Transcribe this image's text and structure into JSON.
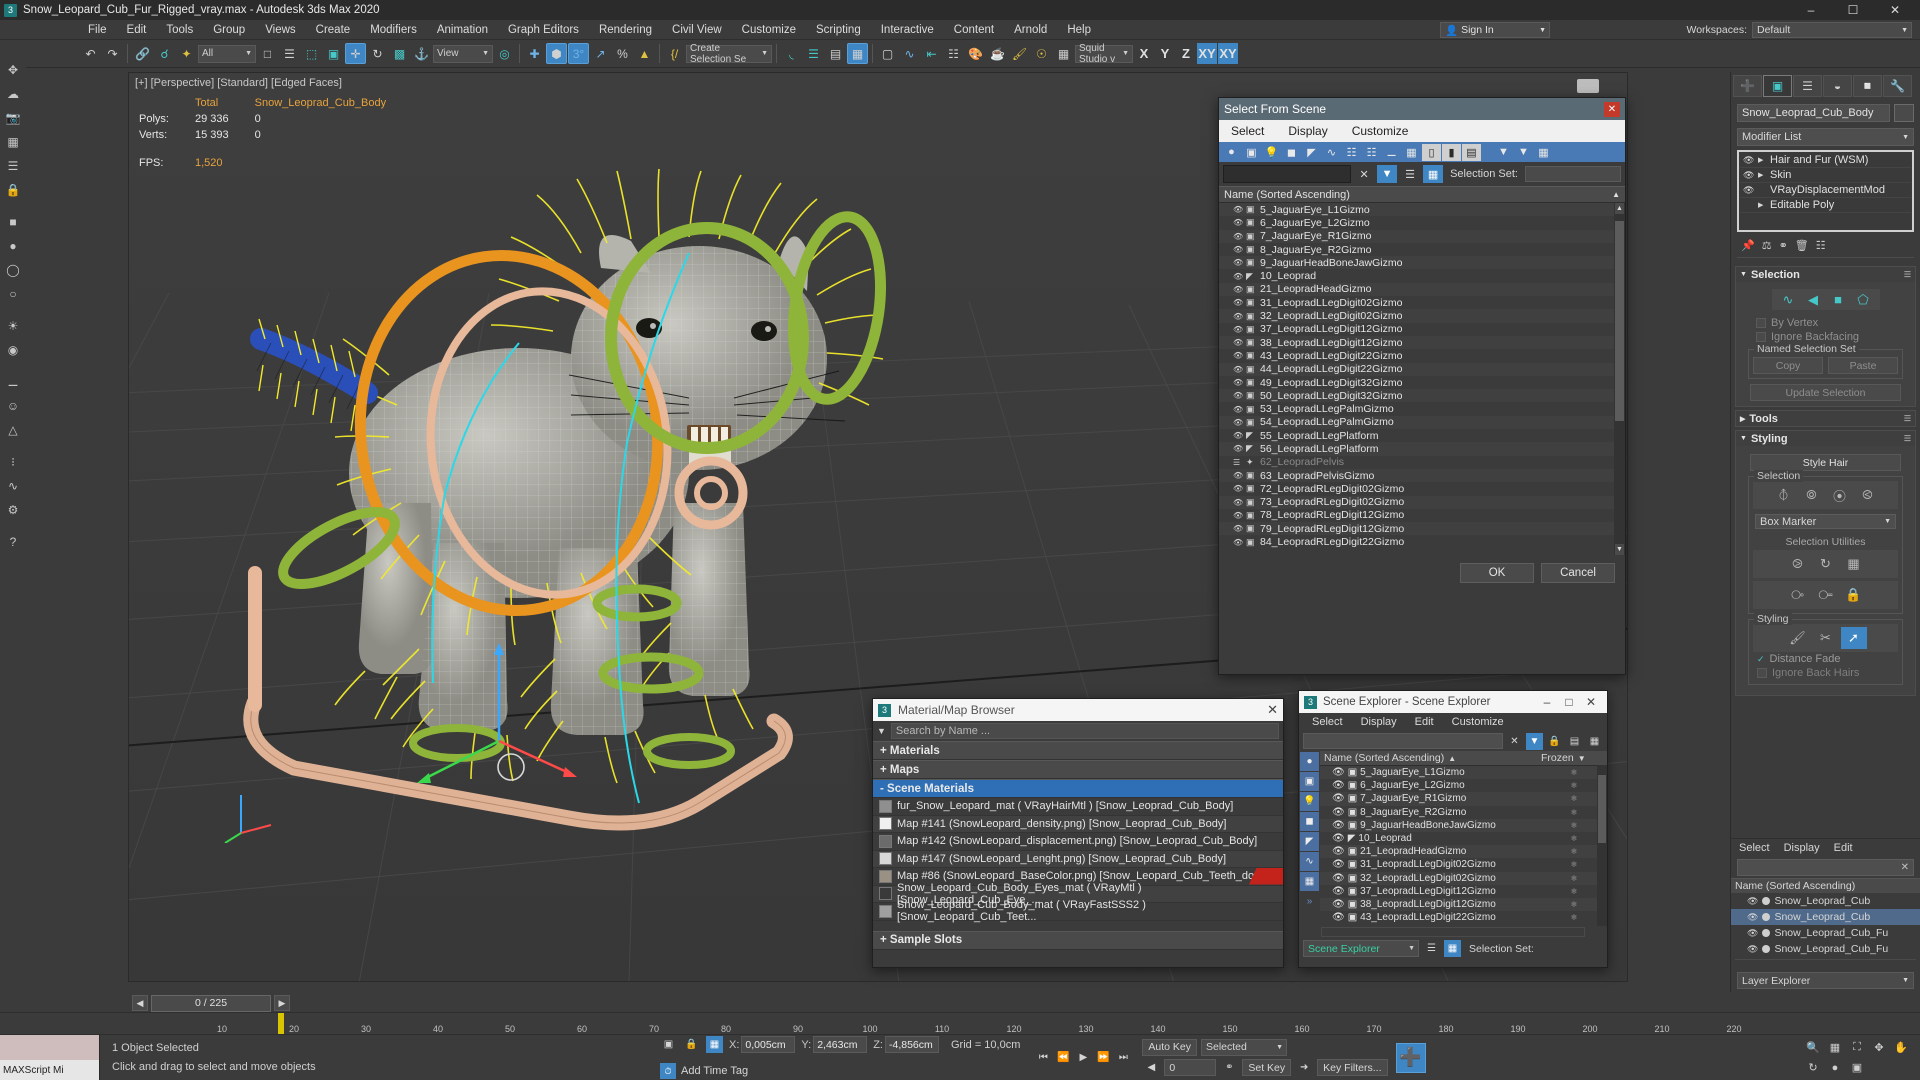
{
  "window": {
    "title": "Snow_Leopard_Cub_Fur_Rigged_vray.max - Autodesk 3ds Max 2020",
    "app_badge": "3",
    "minimize": "–",
    "maximize": "☐",
    "close": "✕"
  },
  "menu": {
    "items": [
      "File",
      "Edit",
      "Tools",
      "Group",
      "Views",
      "Create",
      "Modifiers",
      "Animation",
      "Graph Editors",
      "Rendering",
      "Civil View",
      "Customize",
      "Scripting",
      "Interactive",
      "Content",
      "Arnold",
      "Help"
    ],
    "sign_in": "Sign In",
    "workspaces_label": "Workspaces:",
    "workspaces_value": "Default"
  },
  "toolbar": {
    "undo": "↶",
    "redo": "↷",
    "select_filter": "All",
    "reference_coordinate": "View",
    "named_selection": "Create Selection Se",
    "render_setup_label": "Squid Studio v",
    "axis_x": "X",
    "axis_y": "Y",
    "axis_z": "Z",
    "axis_xy": "XY",
    "axis_xy2": "XY"
  },
  "viewport": {
    "label": "[+] [Perspective] [Standard] [Edged Faces]",
    "stats": {
      "col_total": "Total",
      "col_object": "Snow_Leoprad_Cub_Body",
      "polys_label": "Polys:",
      "polys_total": "29 336",
      "polys_object": "0",
      "verts_label": "Verts:",
      "verts_total": "15 393",
      "verts_object": "0",
      "fps_label": "FPS:",
      "fps_value": "1,520"
    }
  },
  "command_panel": {
    "tabs": [
      "create-tab",
      "modify-tab",
      "hierarchy-tab",
      "motion-tab",
      "display-tab",
      "utilities-tab"
    ],
    "object_name": "Snow_Leoprad_Cub_Body",
    "modifier_list_label": "Modifier List",
    "modifier_stack": [
      {
        "name": "Hair and Fur (WSM)",
        "eye": true,
        "expand": true
      },
      {
        "name": "Skin",
        "eye": true,
        "expand": true
      },
      {
        "name": "VRayDisplacementMod",
        "eye": true,
        "expand": false
      },
      {
        "name": "Editable Poly",
        "eye": false,
        "expand": true
      }
    ],
    "selection_rollout": {
      "title": "Selection",
      "by_vertex": "By Vertex",
      "ignore_backfacing": "Ignore Backfacing",
      "named_selection_set": "Named Selection Set",
      "copy": "Copy",
      "paste": "Paste",
      "update_selection": "Update Selection"
    },
    "tools_rollout": {
      "title": "Tools"
    },
    "styling_rollout": {
      "title": "Styling",
      "style_hair": "Style Hair",
      "selection_label": "Selection",
      "box_marker": "Box Marker",
      "selection_utilities": "Selection Utilities",
      "styling_label": "Styling",
      "distance_fade": "Distance Fade",
      "ignore_back_hairs": "Ignore Back Hairs"
    },
    "bottom_explorer": {
      "menu": [
        "Select",
        "Display",
        "Edit"
      ],
      "header": "Name (Sorted Ascending)",
      "rows": [
        {
          "name": "Snow_Leoprad_Cub",
          "selected": false
        },
        {
          "name": "Snow_Leoprad_Cub",
          "selected": true
        },
        {
          "name": "Snow_Leoprad_Cub_Fu",
          "selected": false
        },
        {
          "name": "Snow_Leoprad_Cub_Fu",
          "selected": false
        }
      ],
      "footer": "Layer Explorer"
    }
  },
  "select_from_scene": {
    "title": "Select From Scene",
    "menu": [
      "Select",
      "Display",
      "Customize"
    ],
    "search_value": "",
    "selection_set_label": "Selection Set:",
    "list_header": "Name (Sorted Ascending)",
    "rows": [
      {
        "name": "5_JaguarEye_L1Gizmo",
        "icon": "gizmo",
        "dim": false
      },
      {
        "name": "6_JaguarEye_L2Gizmo",
        "icon": "gizmo",
        "dim": false
      },
      {
        "name": "7_JaguarEye_R1Gizmo",
        "icon": "gizmo",
        "dim": false
      },
      {
        "name": "8_JaguarEye_R2Gizmo",
        "icon": "gizmo",
        "dim": false
      },
      {
        "name": "9_JaguarHeadBoneJawGizmo",
        "icon": "gizmo",
        "dim": false
      },
      {
        "name": "10_Leoprad",
        "icon": "helper",
        "dim": false
      },
      {
        "name": "21_LeopradHeadGizmo",
        "icon": "gizmo",
        "dim": false
      },
      {
        "name": "31_LeopradLLegDigit02Gizmo",
        "icon": "gizmo",
        "dim": false
      },
      {
        "name": "32_LeopradLLegDigit02Gizmo",
        "icon": "gizmo",
        "dim": false
      },
      {
        "name": "37_LeopradLLegDigit12Gizmo",
        "icon": "gizmo",
        "dim": false
      },
      {
        "name": "38_LeopradLLegDigit12Gizmo",
        "icon": "gizmo",
        "dim": false
      },
      {
        "name": "43_LeopradLLegDigit22Gizmo",
        "icon": "gizmo",
        "dim": false
      },
      {
        "name": "44_LeopradLLegDigit22Gizmo",
        "icon": "gizmo",
        "dim": false
      },
      {
        "name": "49_LeopradLLegDigit32Gizmo",
        "icon": "gizmo",
        "dim": false
      },
      {
        "name": "50_LeopradLLegDigit32Gizmo",
        "icon": "gizmo",
        "dim": false
      },
      {
        "name": "53_LeopradLLegPalmGizmo",
        "icon": "gizmo",
        "dim": false
      },
      {
        "name": "54_LeopradLLegPalmGizmo",
        "icon": "gizmo",
        "dim": false
      },
      {
        "name": "55_LeopradLLegPlatform",
        "icon": "helper",
        "dim": false
      },
      {
        "name": "56_LeopradLLegPlatform",
        "icon": "helper",
        "dim": false
      },
      {
        "name": "62_LeopradPelvis",
        "icon": "layer",
        "dim": true
      },
      {
        "name": "63_LeopradPelvisGizmo",
        "icon": "gizmo",
        "dim": false
      },
      {
        "name": "72_LeopradRLegDigit02Gizmo",
        "icon": "gizmo",
        "dim": false
      },
      {
        "name": "73_LeopradRLegDigit02Gizmo",
        "icon": "gizmo",
        "dim": false
      },
      {
        "name": "78_LeopradRLegDigit12Gizmo",
        "icon": "gizmo",
        "dim": false
      },
      {
        "name": "79_LeopradRLegDigit12Gizmo",
        "icon": "gizmo",
        "dim": false
      },
      {
        "name": "84_LeopradRLegDigit22Gizmo",
        "icon": "gizmo",
        "dim": false
      }
    ],
    "ok": "OK",
    "cancel": "Cancel"
  },
  "material_browser": {
    "title": "Material/Map Browser",
    "badge": "3",
    "search_placeholder": "Search by Name ...",
    "groups": [
      {
        "label": "+ Materials",
        "active": false
      },
      {
        "label": "+ Maps",
        "active": false
      },
      {
        "label": "- Scene Materials",
        "active": true
      }
    ],
    "scene_materials": [
      {
        "name": "fur_Snow_Leopard_mat ( VRayHairMtl ) [Snow_Leoprad_Cub_Body]",
        "swatch": "#8f8f8f",
        "flag": false
      },
      {
        "name": "Map #141 (SnowLeopard_density.png) [Snow_Leoprad_Cub_Body]",
        "swatch": "#f0f0f0",
        "flag": false
      },
      {
        "name": "Map #142 (SnowLeopard_displacement.png) [Snow_Leoprad_Cub_Body]",
        "swatch": "#6b6b6b",
        "flag": false
      },
      {
        "name": "Map #147 (SnowLeopard_Lenght.png) [Snow_Leoprad_Cub_Body]",
        "swatch": "#d8d8d8",
        "flag": false
      },
      {
        "name": "Map #86 (SnowLeopard_BaseColor.png) [Snow_Leopard_Cub_Teeth_down,...",
        "swatch": "#9a9184",
        "flag": true
      },
      {
        "name": "Snow_Leopard_Cub_Body_Eyes_mat ( VRayMtl ) [Snow_Leopard_Cub_Eye_...",
        "swatch": "#444444",
        "flag": false
      },
      {
        "name": "Snow_Leopard_Cub_Body_mat ( VRayFastSSS2 ) [Snow_Leopard_Cub_Teet...",
        "swatch": "#a0a0a0",
        "flag": false
      }
    ],
    "sample_slots": "+ Sample Slots"
  },
  "scene_explorer": {
    "title": "Scene Explorer - Scene Explorer",
    "badge": "3",
    "minimize": "–",
    "maximize": "□",
    "close": "✕",
    "menu": [
      "Select",
      "Display",
      "Edit",
      "Customize"
    ],
    "search_value": "",
    "col_name": "Name (Sorted Ascending)",
    "col_frozen": "Frozen",
    "rows": [
      {
        "name": "5_JaguarEye_L1Gizmo"
      },
      {
        "name": "6_JaguarEye_L2Gizmo"
      },
      {
        "name": "7_JaguarEye_R1Gizmo"
      },
      {
        "name": "8_JaguarEye_R2Gizmo"
      },
      {
        "name": "9_JaguarHeadBoneJawGizmo"
      },
      {
        "name": "10_Leoprad"
      },
      {
        "name": "21_LeopradHeadGizmo"
      },
      {
        "name": "31_LeopradLLegDigit02Gizmo"
      },
      {
        "name": "32_LeopradLLegDigit02Gizmo"
      },
      {
        "name": "37_LeopradLLegDigit12Gizmo"
      },
      {
        "name": "38_LeopradLLegDigit12Gizmo"
      },
      {
        "name": "43_LeopradLLegDigit22Gizmo"
      }
    ],
    "footer_dropdown": "Scene Explorer",
    "footer_label": "Selection Set:"
  },
  "timeline": {
    "prev": "◀",
    "next": "▶",
    "frame_display": "0 / 225",
    "ruler_ticks": [
      "10",
      "20",
      "30",
      "40",
      "50",
      "60",
      "70",
      "80",
      "90",
      "100",
      "110",
      "120",
      "130",
      "140",
      "150",
      "160",
      "170",
      "180",
      "190",
      "200",
      "210",
      "220"
    ]
  },
  "status_bar": {
    "maxscript_label": "MAXScript Mi",
    "objects_selected": "1 Object Selected",
    "prompt": "Click and drag to select and move objects",
    "x_label": "X:",
    "x_value": "0,005cm",
    "y_label": "Y:",
    "y_value": "2,463cm",
    "z_label": "Z:",
    "z_value": "-4,856cm",
    "grid": "Grid = 10,0cm",
    "add_time_tag": "Add Time Tag",
    "auto_key": "Auto Key",
    "selected_filter": "Selected",
    "set_key": "Set Key",
    "key_filters": "Key Filters...",
    "key_frame_value": "0"
  },
  "colors": {
    "accent_blue": "#3f86c4",
    "cyan": "#46c8c8",
    "dialog_title": "#5a6a74",
    "red_close": "#c43a2a",
    "yellow_hair": "#f2ea2a",
    "orange_ring": "#e8941f",
    "green_ring": "#8fb43a",
    "blue_ring": "#2b4fb8",
    "skin_peach": "#e8b89a",
    "stat_orange": "#e8a33d"
  }
}
